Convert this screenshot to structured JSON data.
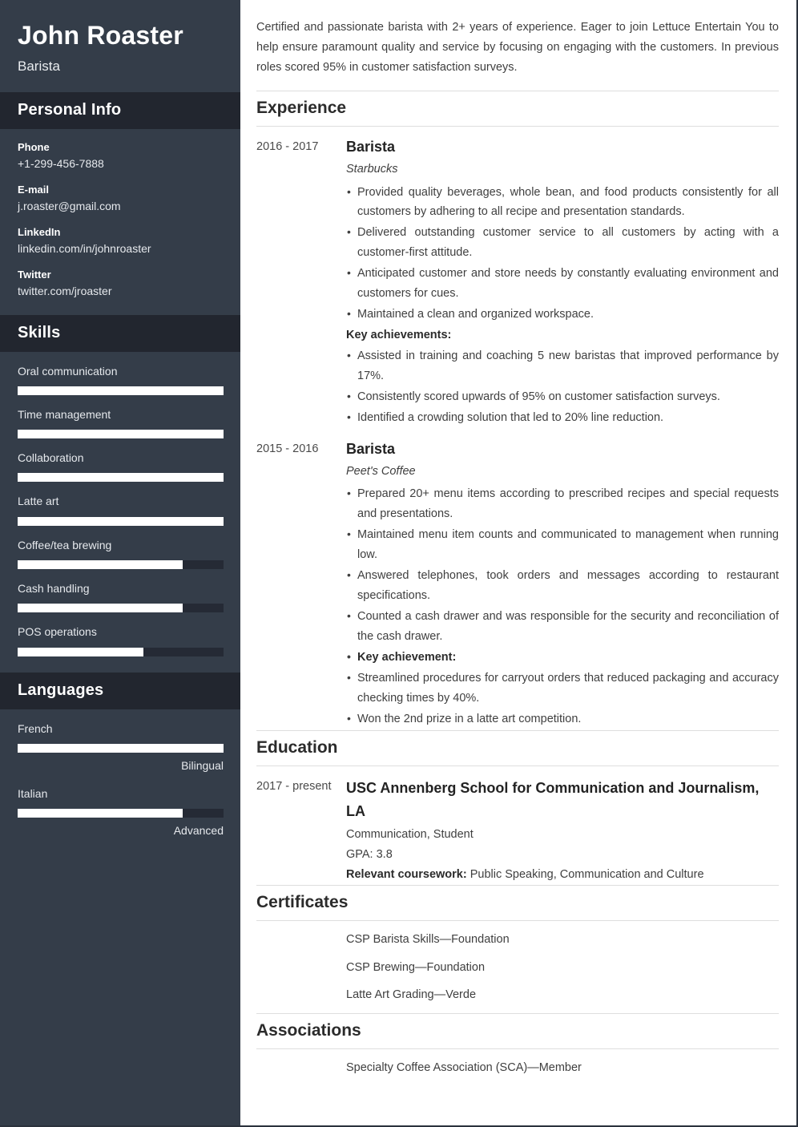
{
  "colors": {
    "sidebar_bg": "#343d49",
    "sidebar_header_bg": "#22262f",
    "bar_track": "#252a35",
    "bar_fill": "#ffffff",
    "main_text": "#3f3f3f",
    "rule": "#dedede"
  },
  "sidebar": {
    "name": "John Roaster",
    "title": "Barista",
    "personal_info": {
      "heading": "Personal Info",
      "items": [
        {
          "label": "Phone",
          "value": "+1-299-456-7888"
        },
        {
          "label": "E-mail",
          "value": "j.roaster@gmail.com"
        },
        {
          "label": "LinkedIn",
          "value": "linkedin.com/in/johnroaster"
        },
        {
          "label": "Twitter",
          "value": "twitter.com/jroaster"
        }
      ]
    },
    "skills": {
      "heading": "Skills",
      "items": [
        {
          "name": "Oral communication",
          "level": 100
        },
        {
          "name": "Time management",
          "level": 100
        },
        {
          "name": "Collaboration",
          "level": 100
        },
        {
          "name": "Latte art",
          "level": 100
        },
        {
          "name": "Coffee/tea brewing",
          "level": 80
        },
        {
          "name": "Cash handling",
          "level": 80
        },
        {
          "name": "POS operations",
          "level": 61
        }
      ]
    },
    "languages": {
      "heading": "Languages",
      "items": [
        {
          "name": "French",
          "level": 100,
          "proficiency": "Bilingual"
        },
        {
          "name": "Italian",
          "level": 80,
          "proficiency": "Advanced"
        }
      ]
    }
  },
  "main": {
    "summary": "Certified and passionate barista with 2+ years of experience. Eager to join Lettuce Entertain You to help ensure paramount quality and service by focusing on engaging with the customers. In previous roles scored 95% in customer satisfaction surveys.",
    "experience": {
      "heading": "Experience",
      "entries": [
        {
          "date": "2016 - 2017",
          "role": "Barista",
          "org": "Starbucks",
          "bullets": [
            {
              "text": "Provided quality beverages, whole bean, and food products consistently for all customers by adhering to all recipe and presentation standards.",
              "bullet": true,
              "bold": false
            },
            {
              "text": "Delivered outstanding customer service to all customers by acting with a customer-first attitude.",
              "bullet": true,
              "bold": false
            },
            {
              "text": "Anticipated customer and store needs by constantly evaluating environment and customers for cues.",
              "bullet": true,
              "bold": false
            },
            {
              "text": "Maintained a clean and organized workspace.",
              "bullet": true,
              "bold": false
            },
            {
              "text": "Key achievements:",
              "bullet": false,
              "bold": true
            },
            {
              "text": "Assisted in training and coaching 5 new baristas that improved performance by 17%.",
              "bullet": true,
              "bold": false
            },
            {
              "text": "Consistently scored upwards of 95% on customer satisfaction surveys.",
              "bullet": true,
              "bold": false
            },
            {
              "text": "Identified a crowding solution that led to 20% line reduction.",
              "bullet": true,
              "bold": false
            }
          ]
        },
        {
          "date": "2015 - 2016",
          "role": "Barista",
          "org": "Peet's Coffee",
          "bullets": [
            {
              "text": "Prepared 20+ menu items according to prescribed recipes and special requests and presentations.",
              "bullet": true,
              "bold": false
            },
            {
              "text": "Maintained menu item counts and communicated to management when running low.",
              "bullet": true,
              "bold": false
            },
            {
              "text": "Answered telephones, took orders and messages according to restaurant specifications.",
              "bullet": true,
              "bold": false
            },
            {
              "text": "Counted a cash drawer and was responsible for the security and reconciliation of the cash drawer.",
              "bullet": true,
              "bold": false
            },
            {
              "text": "Key achievement:",
              "bullet": true,
              "bold": true
            },
            {
              "text": "Streamlined procedures for carryout orders that reduced packaging and accuracy checking times by 40%.",
              "bullet": true,
              "bold": false
            },
            {
              "text": "Won the 2nd prize in a latte art competition.",
              "bullet": true,
              "bold": false
            }
          ]
        }
      ]
    },
    "education": {
      "heading": "Education",
      "entries": [
        {
          "date": "2017 - present",
          "degree": "USC Annenberg School for Communication and Journalism, LA",
          "field": "Communication, Student",
          "gpa": "GPA: 3.8",
          "coursework_label": "Relevant coursework:",
          "coursework_value": "Public Speaking, Communication and Culture"
        }
      ]
    },
    "certificates": {
      "heading": "Certificates",
      "items": [
        "CSP Barista Skills—Foundation",
        "CSP Brewing—Foundation",
        "Latte Art Grading—Verde"
      ]
    },
    "associations": {
      "heading": "Associations",
      "items": [
        "Specialty Coffee Association (SCA)—Member"
      ]
    }
  }
}
